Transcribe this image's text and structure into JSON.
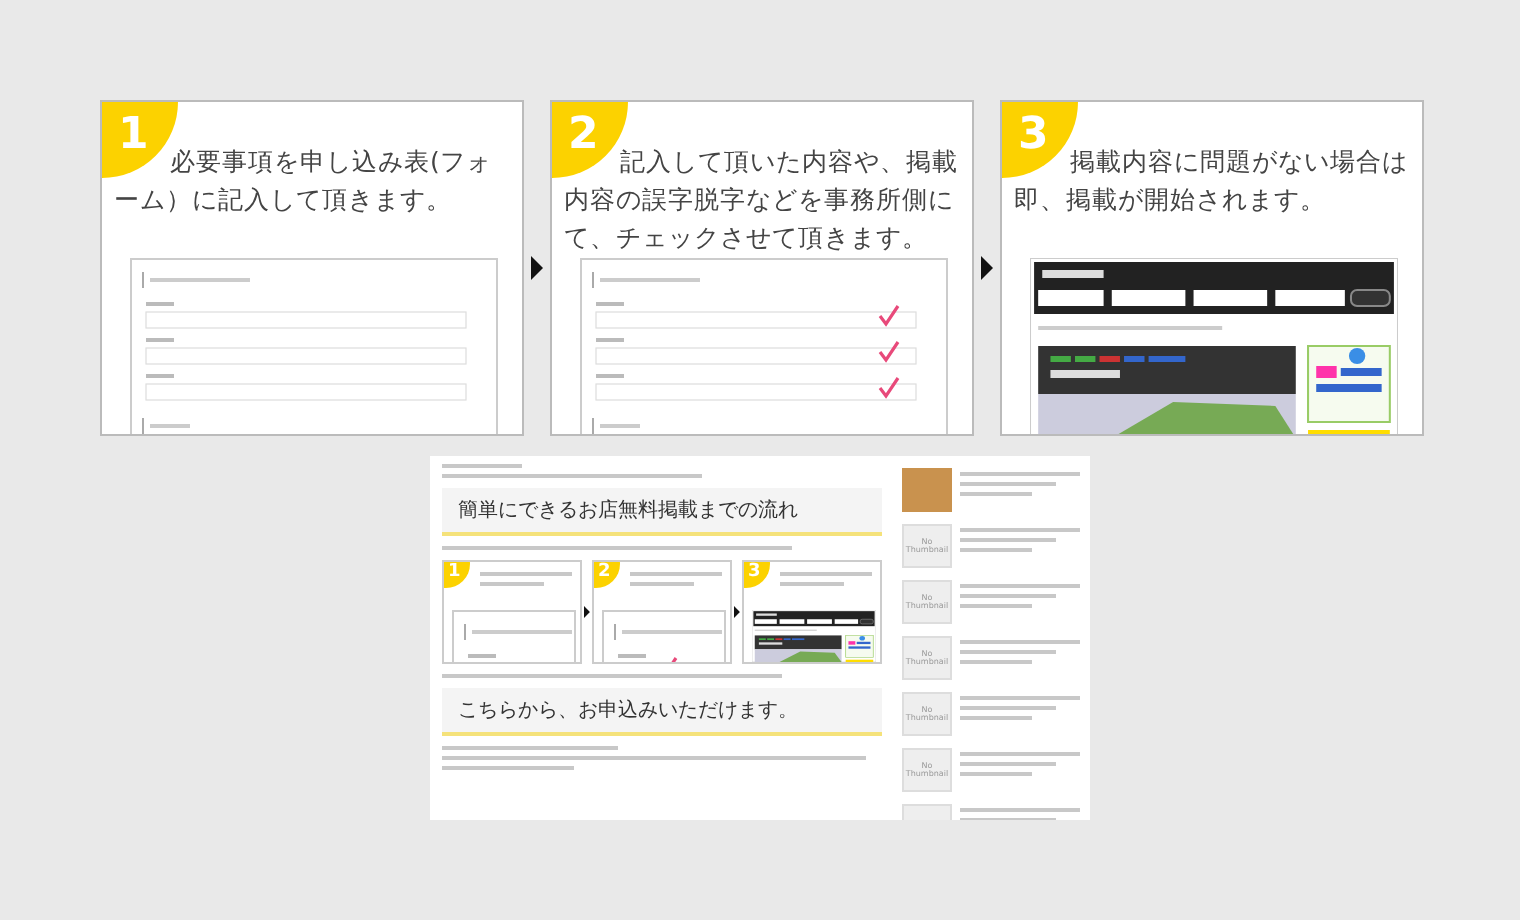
{
  "steps": [
    {
      "number": "1",
      "text": "必要事項を申し込み表(フォーム）に記入して頂きます。",
      "kind": "form"
    },
    {
      "number": "2",
      "text": "記入して頂いた内容や、掲載内容の誤字脱字などを事務所側にて、チェックさせて頂きます。",
      "kind": "checked-form"
    },
    {
      "number": "3",
      "text": "掲載内容に問題がない場合は即、掲載が開始されます。",
      "kind": "site"
    }
  ],
  "embedded_page": {
    "headings": [
      "簡単にできるお店無料掲載までの流れ",
      "こちらから、お申込みいただけます。"
    ],
    "steps": [
      {
        "number": "1",
        "kind": "form"
      },
      {
        "number": "2",
        "kind": "checked-form"
      },
      {
        "number": "3",
        "kind": "site"
      }
    ],
    "sidebar": [
      {
        "kind": "photo"
      },
      {
        "kind": "no-thumbnail",
        "label": "No Thumbnail"
      },
      {
        "kind": "no-thumbnail",
        "label": "No Thumbnail"
      },
      {
        "kind": "no-thumbnail",
        "label": "No Thumbnail"
      },
      {
        "kind": "no-thumbnail",
        "label": "No Thumbnail"
      },
      {
        "kind": "no-thumbnail",
        "label": "No Thumbnail"
      },
      {
        "kind": "no-thumbnail"
      }
    ]
  }
}
